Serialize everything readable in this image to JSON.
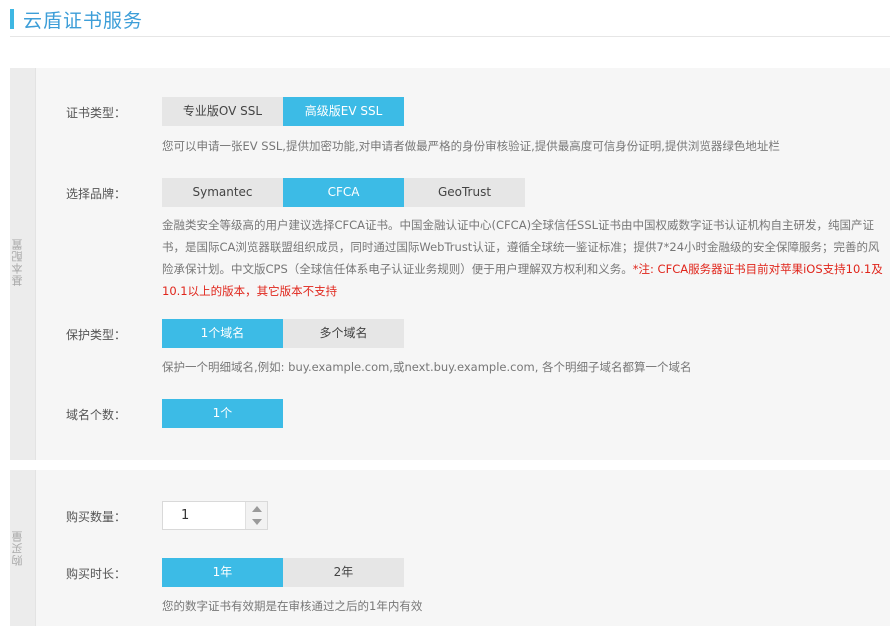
{
  "page": {
    "title": "云盾证书服务"
  },
  "basic": {
    "side_label": "基本配置",
    "cert_type": {
      "label": "证书类型：",
      "options": [
        "专业版OV SSL",
        "高级版EV SSL"
      ],
      "selected": "高级版EV SSL",
      "description": "您可以申请一张EV SSL,提供加密功能,对申请者做最严格的身份审核验证,提供最高度可信身份证明,提供浏览器绿色地址栏"
    },
    "brand": {
      "label": "选择品牌：",
      "options": [
        "Symantec",
        "CFCA",
        "GeoTrust"
      ],
      "selected": "CFCA",
      "description": "金融类安全等级高的用户建议选择CFCA证书。中国金融认证中心(CFCA)全球信任SSL证书由中国权威数字证书认证机构自主研发，纯国产证书，是国际CA浏览器联盟组织成员，同时通过国际WebTrust认证，遵循全球统一鉴证标准；提供7*24小时金融级的安全保障服务；完善的风险承保计划。中文版CPS（全球信任体系电子认证业务规则）便于用户理解双方权利和义务。",
      "warning": "*注: CFCA服务器证书目前对苹果iOS支持10.1及10.1以上的版本，其它版本不支持"
    },
    "protect_type": {
      "label": "保护类型：",
      "options": [
        "1个域名",
        "多个域名"
      ],
      "selected": "1个域名",
      "description": "保护一个明细域名,例如: buy.example.com,或next.buy.example.com, 各个明细子域名都算一个域名"
    },
    "domain_count": {
      "label": "域名个数：",
      "value": "1个"
    }
  },
  "buy": {
    "side_label": "购买量",
    "quantity": {
      "label": "购买数量：",
      "value": "1"
    },
    "duration": {
      "label": "购买时长：",
      "options": [
        "1年",
        "2年"
      ],
      "selected": "1年",
      "description": "您的数字证书有效期是在审核通过之后的1年内有效"
    }
  },
  "colors": {
    "accent": "#3cbbe6",
    "title": "#3d9ed8",
    "warning": "#e0251b"
  }
}
